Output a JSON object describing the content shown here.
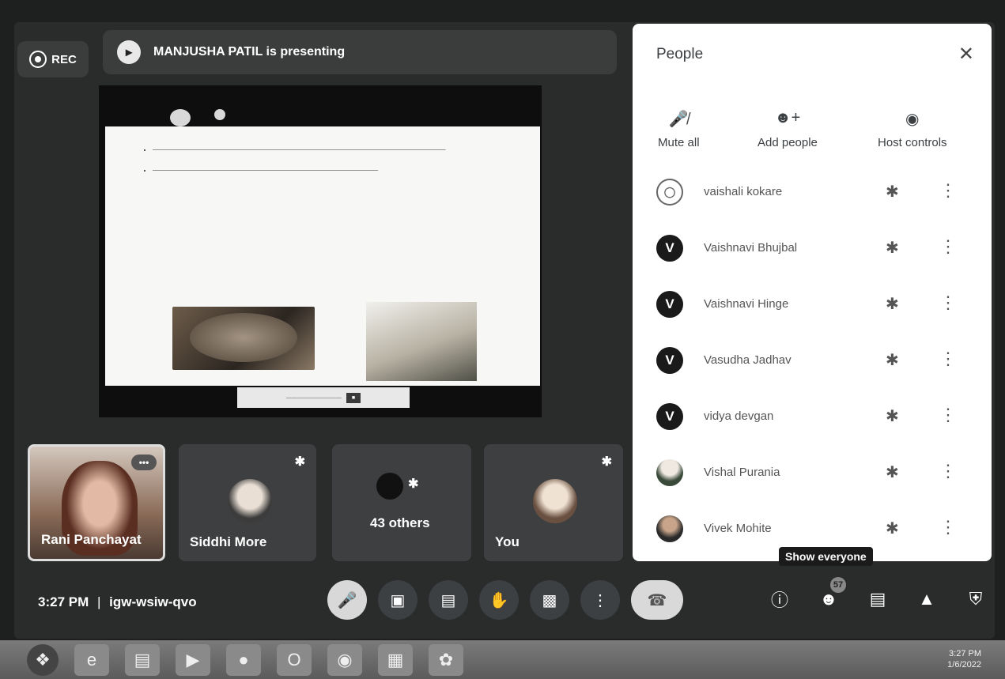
{
  "header": {
    "rec_label": "REC",
    "presenting_text": "MANJUSHA PATIL is presenting"
  },
  "people_panel": {
    "title": "People",
    "actions": [
      {
        "label": "Mute all",
        "icon": "mic-off-icon"
      },
      {
        "label": "Add people",
        "icon": "add-person-icon"
      },
      {
        "label": "Host controls",
        "icon": "toggle-icon"
      }
    ],
    "participants": [
      {
        "name": "vaishali kokare",
        "initial": "",
        "avatar": "outline"
      },
      {
        "name": "Vaishnavi Bhujbal",
        "initial": "V",
        "avatar": "letter"
      },
      {
        "name": "Vaishnavi Hinge",
        "initial": "V",
        "avatar": "letter"
      },
      {
        "name": "Vasudha Jadhav",
        "initial": "V",
        "avatar": "letter"
      },
      {
        "name": "vidya devgan",
        "initial": "V",
        "avatar": "letter"
      },
      {
        "name": "Vishal Purania",
        "initial": "",
        "avatar": "photo"
      },
      {
        "name": "Vivek Mohite",
        "initial": "",
        "avatar": "photo"
      }
    ]
  },
  "tooltip": "Show everyone",
  "tiles": [
    {
      "label": "Rani Panchayat"
    },
    {
      "label": "Siddhi More"
    },
    {
      "label": "43 others"
    },
    {
      "label": "You"
    }
  ],
  "meeting": {
    "time": "3:27 PM",
    "separator": "|",
    "code": "igw-wsiw-qvo"
  },
  "participant_count": "57",
  "controls": [
    "mic-off-icon",
    "camera-icon",
    "captions-icon",
    "raise-hand-icon",
    "present-icon",
    "more-options-icon",
    "hang-up-icon"
  ],
  "right_controls": [
    "info-icon",
    "people-icon",
    "chat-icon",
    "activities-icon",
    "host-shield-icon"
  ],
  "taskbar": {
    "clock": "3:27 PM",
    "date": "1/6/2022"
  },
  "colors": {
    "background": "#2a2b2b",
    "panel": "#ffffff",
    "accent": "#3c4043"
  }
}
